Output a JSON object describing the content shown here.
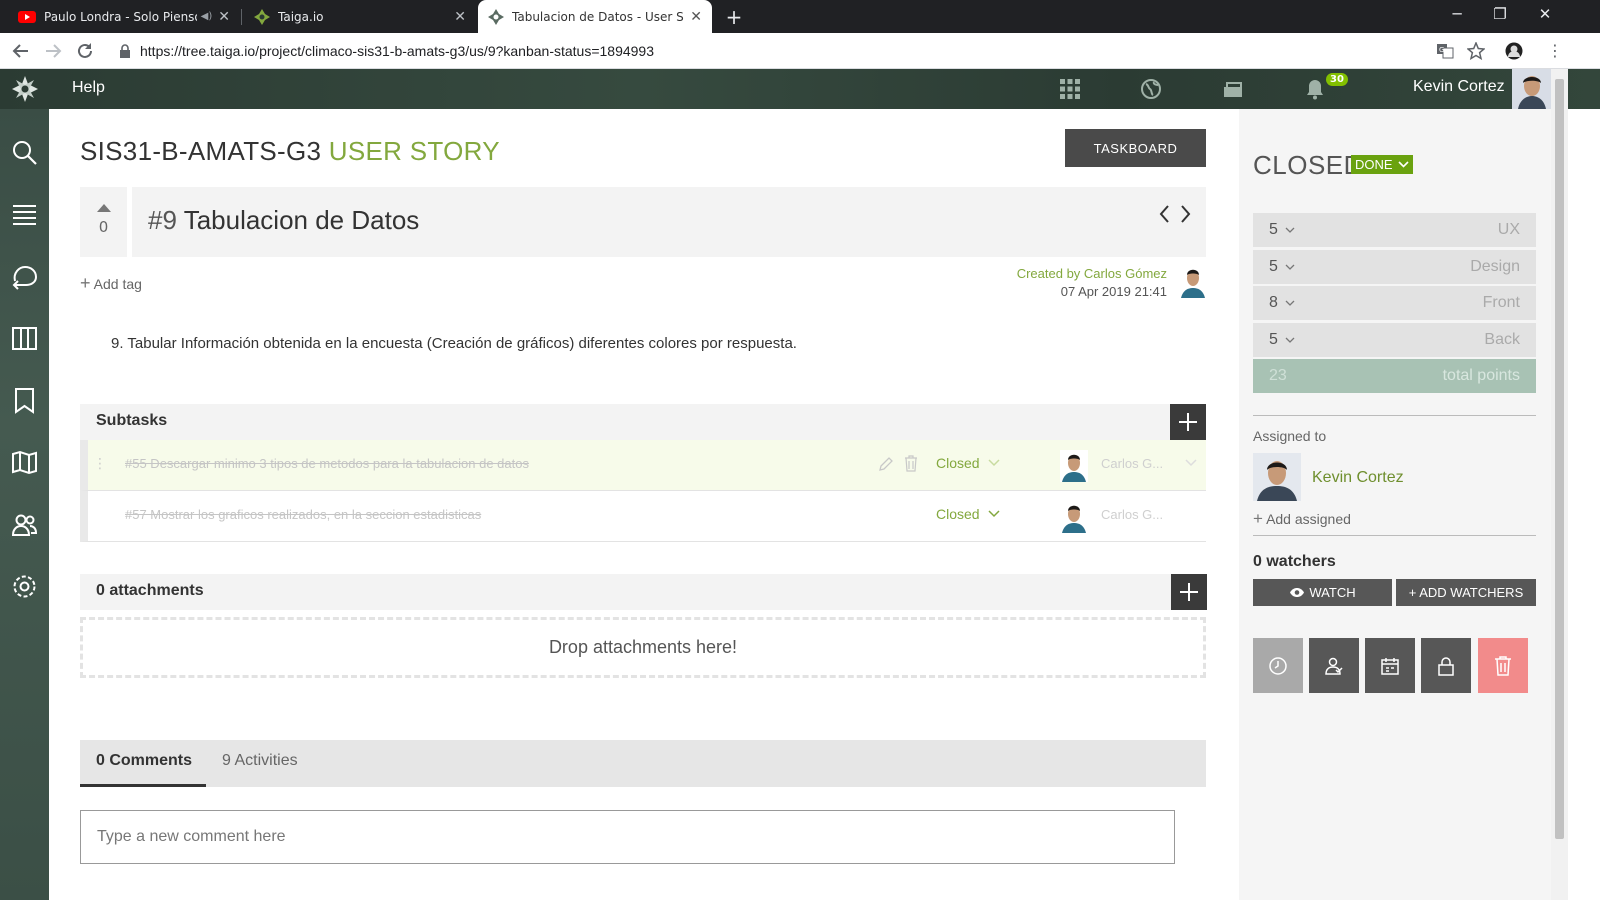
{
  "browser": {
    "tabs": [
      {
        "title": "Paulo Londra - Solo Pienso e",
        "icon": "youtube-icon"
      },
      {
        "title": "Taiga.io",
        "icon": "taiga-icon"
      },
      {
        "title": "Tabulacion de Datos - User Story",
        "icon": "taiga-icon"
      }
    ],
    "url": "https://tree.taiga.io/project/climaco-sis31-b-amats-g3/us/9?kanban-status=1894993"
  },
  "topbar": {
    "help_label": "Help",
    "notifications_count": "30",
    "user_name": "Kevin Cortez"
  },
  "header": {
    "project_name": "SIS31-B-AMATS-G3",
    "kind": "USER STORY",
    "taskboard_label": "TASKBOARD"
  },
  "story": {
    "votes": "0",
    "number": "#9",
    "title": "Tabulacion de Datos",
    "add_tag_label": "Add tag",
    "created_by": "Created by Carlos Gómez",
    "created_date": "07 Apr 2019 21:41",
    "description": "9. Tabular Información obtenida en la encuesta (Creación de gráficos) diferentes colores por respuesta."
  },
  "subtasks": {
    "title": "Subtasks",
    "items": [
      {
        "text": "#55 Descargar minimo 3 tipos de metodos para la tabulacion de datos",
        "status": "Closed",
        "assignee": "Carlos G..."
      },
      {
        "text": "#57 Mostrar los graficos realizados, en la seccion estadisticas",
        "status": "Closed",
        "assignee": "Carlos G..."
      }
    ]
  },
  "attachments": {
    "title": "0 attachments",
    "drop_label": "Drop attachments here!"
  },
  "comments": {
    "tab_comments": "0 Comments",
    "tab_activities": "9 Activities",
    "placeholder": "Type a new comment here"
  },
  "sidebar_right": {
    "status": "CLOSED",
    "status_tag": "DONE",
    "points": [
      {
        "value": "5",
        "role": "UX"
      },
      {
        "value": "5",
        "role": "Design"
      },
      {
        "value": "8",
        "role": "Front"
      },
      {
        "value": "5",
        "role": "Back"
      }
    ],
    "total_value": "23",
    "total_label": "total points",
    "assigned_to_label": "Assigned to",
    "assigned_name": "Kevin Cortez",
    "add_assigned_label": "Add assigned",
    "watchers_label": "0 watchers",
    "watch_label": "WATCH",
    "add_watchers_label": "+ ADD WATCHERS"
  },
  "colors": {
    "accent_green": "#83a83e",
    "done_green": "#6aa20f",
    "delete_red": "#f28b8b",
    "dark_button": "#575757"
  }
}
